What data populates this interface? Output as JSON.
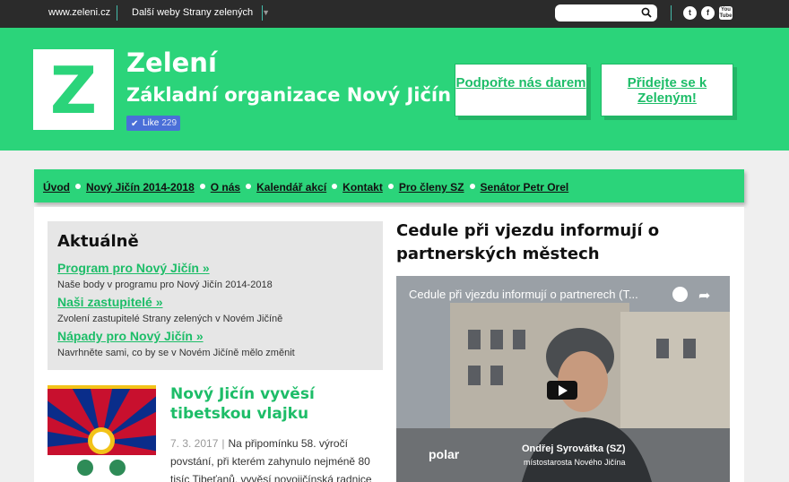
{
  "topbar": {
    "site_link": "www.zeleni.cz",
    "other_sites": "Další weby Strany zelených",
    "search_placeholder": "",
    "social": [
      "twitter-icon",
      "facebook-icon",
      "youtube-icon"
    ]
  },
  "header": {
    "logo_letter": "Z",
    "title": "Zelení",
    "subtitle": "Základní organizace Nový Jičín",
    "like_label": "Like",
    "like_count": "229",
    "cta_donate": "Podpořte nás darem",
    "cta_join": "Přidejte se k Zeleným!"
  },
  "nav": {
    "items": [
      "Úvod",
      "Nový Jičín 2014-2018",
      "O nás",
      "Kalendář akcí",
      "Kontakt",
      "Pro členy SZ",
      "Senátor Petr Orel"
    ]
  },
  "news": {
    "heading": "Aktuálně",
    "items": [
      {
        "link": "Program pro Nový Jičín »",
        "desc": "Naše body v programu pro Nový Jičín 2014-2018"
      },
      {
        "link": "Naši zastupitelé »",
        "desc": "Zvolení zastupitelé Strany zelených v Novém Jičíně"
      },
      {
        "link": "Nápady pro Nový Jičín »",
        "desc": "Navrhněte sami, co by se v Novém Jičíně mělo změnit"
      }
    ]
  },
  "article": {
    "title": "Nový Jičín vyvěsí tibetskou vlajku",
    "date": "7. 3. 2017",
    "excerpt": "Na připomínku 58. výročí povstání, při kterém zahynulo nejméně 80 tisíc Tibeťanů, vyvěsí novojičínská radnice"
  },
  "featured": {
    "title": "Cedule při vjezdu informují o partnerských městech",
    "video_title": "Cedule při vjezdu informují o partnerech (T...",
    "video_person": "Ondřej Syrovátka (SZ)",
    "video_role": "místostarosta Nového Jičína",
    "video_logo": "polar"
  },
  "colors": {
    "brand_green": "#2bd47a",
    "link_green": "#1dbd68",
    "topbar": "#2b2b2b"
  }
}
